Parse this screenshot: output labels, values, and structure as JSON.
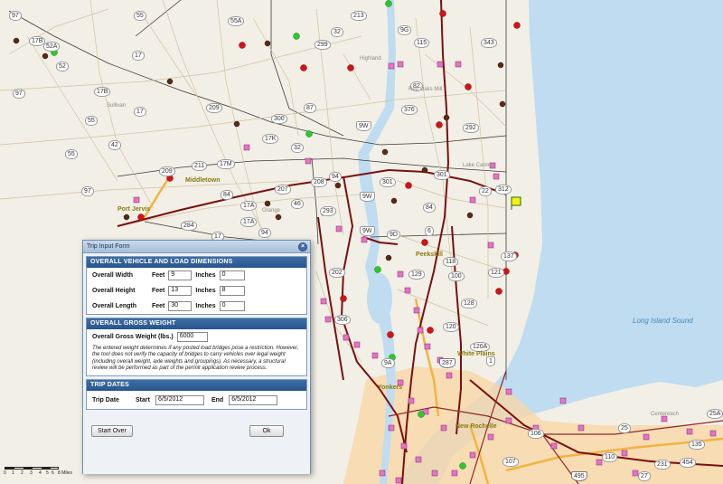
{
  "map": {
    "route_shields": [
      {
        "t": "97"
      },
      {
        "t": "17B"
      },
      {
        "t": "52A"
      },
      {
        "t": "55"
      },
      {
        "t": "55A"
      },
      {
        "t": "213"
      },
      {
        "t": "9G"
      },
      {
        "t": "115"
      },
      {
        "t": "343"
      },
      {
        "t": "52"
      },
      {
        "t": "17"
      },
      {
        "t": "42"
      },
      {
        "t": "17B"
      },
      {
        "t": "97"
      },
      {
        "t": "55"
      },
      {
        "t": "209"
      },
      {
        "t": "17"
      },
      {
        "t": "97"
      },
      {
        "t": "209"
      },
      {
        "t": "211"
      },
      {
        "t": "17M"
      },
      {
        "t": "84"
      },
      {
        "t": "207"
      },
      {
        "t": "208"
      },
      {
        "t": "94"
      },
      {
        "t": "9W"
      },
      {
        "t": "301"
      },
      {
        "t": "84"
      },
      {
        "t": "312"
      },
      {
        "t": "22"
      },
      {
        "t": "284"
      },
      {
        "t": "17A"
      },
      {
        "t": "94"
      },
      {
        "t": "17"
      },
      {
        "t": "293"
      },
      {
        "t": "9W"
      },
      {
        "t": "9D"
      },
      {
        "t": "202"
      },
      {
        "t": "118"
      },
      {
        "t": "121"
      },
      {
        "t": "137"
      },
      {
        "t": "129"
      },
      {
        "t": "100"
      },
      {
        "t": "128"
      },
      {
        "t": "306"
      },
      {
        "t": "120"
      },
      {
        "t": "120A"
      },
      {
        "t": "9A"
      },
      {
        "t": "287"
      },
      {
        "t": "106"
      },
      {
        "t": "25"
      },
      {
        "t": "110"
      },
      {
        "t": "454"
      },
      {
        "t": "495"
      },
      {
        "t": "27"
      },
      {
        "t": "25A"
      },
      {
        "t": "32"
      },
      {
        "t": "299"
      },
      {
        "t": "376"
      },
      {
        "t": "292"
      },
      {
        "t": "87"
      },
      {
        "t": "82"
      },
      {
        "t": "55"
      },
      {
        "t": "17K"
      },
      {
        "t": "300"
      },
      {
        "t": "32"
      },
      {
        "t": "46"
      },
      {
        "t": "301"
      },
      {
        "t": "6"
      },
      {
        "t": "9W"
      },
      {
        "t": "17A"
      },
      {
        "t": "1"
      },
      {
        "t": "107"
      },
      {
        "t": "231"
      },
      {
        "t": "135"
      }
    ],
    "town_labels": [
      {
        "t": "Middletown"
      },
      {
        "t": "Port Jervis"
      },
      {
        "t": "Peekskill"
      },
      {
        "t": "Yonkers"
      },
      {
        "t": "White Plains"
      },
      {
        "t": "New Rochelle"
      }
    ],
    "place_labels": [
      {
        "t": "Sullivan"
      },
      {
        "t": "Highland"
      },
      {
        "t": "Red Oaks Mill"
      },
      {
        "t": "Lake Carmel"
      },
      {
        "t": "Orange"
      },
      {
        "t": "Centereach"
      }
    ],
    "water_label": "Long Island Sound",
    "colors": {
      "land": "#f2efe6",
      "water": "#bfdcf0",
      "state_road": "#d0c4a4",
      "highway": "#7a1010",
      "parkway": "#f0b440",
      "urban": "#f7d7a8",
      "pink_marker": "#e872c8",
      "red_marker": "#d21414",
      "brown_marker": "#5a2a14",
      "green_marker": "#2ec82e"
    },
    "scale_labels": [
      "0",
      "1",
      "2",
      "3",
      "4",
      "5",
      "6",
      "8 Miles"
    ]
  },
  "form": {
    "title": "Trip Input Form",
    "dimensions_header": "OVERALL VEHICLE AND LOAD DIMENSIONS",
    "rows": [
      {
        "label": "Overall Width",
        "feet_label": "Feet",
        "feet": "9",
        "inches_label": "Inches",
        "inches": "0"
      },
      {
        "label": "Overall Height",
        "feet_label": "Feet",
        "feet": "13",
        "inches_label": "Inches",
        "inches": "8"
      },
      {
        "label": "Overall Length",
        "feet_label": "Feet",
        "feet": "30",
        "inches_label": "Inches",
        "inches": "0"
      }
    ],
    "weight_header": "OVERALL GROSS WEIGHT",
    "weight_label": "Overall Gross Weight (lbs.)",
    "weight_value": "6000",
    "weight_note": "The entered weight determines if any posted load bridges pose a restriction. However, the tool does not verify the capacity of bridges to carry vehicles over legal weight (including overall weight, axle weights and groupings). As necessary, a structural review will be performed as part of the permit application review process.",
    "dates_header": "TRIP DATES",
    "trip_date_label": "Trip Date",
    "start_label": "Start",
    "start_value": "6/5/2012",
    "end_label": "End",
    "end_value": "6/5/2012",
    "start_over_label": "Start Over",
    "ok_label": "Ok",
    "close_label": "×"
  }
}
